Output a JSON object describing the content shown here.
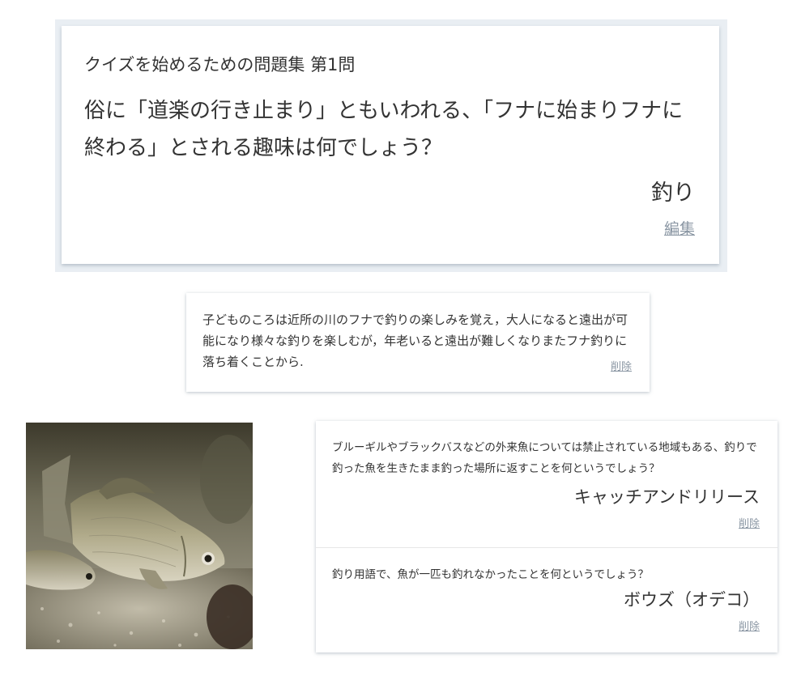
{
  "quiz": {
    "label": "クイズを始めるための問題集 第1問",
    "question": "俗に「道楽の行き止まり」ともいわれる、「フナに始まりフナに終わる」とされる趣味は何でしょう？",
    "answer": "釣り",
    "edit_label": "編集"
  },
  "explanation": {
    "text": "子どものころは近所の川のフナで釣りの楽しみを覚え，大人になると遠出が可能になり様々な釣りを楽しむが，年老いると遠出が難しくなりまたフナ釣りに落ち着くことから.",
    "delete_label": "削除"
  },
  "image": {
    "subject": "fish-photo"
  },
  "related": [
    {
      "question": "ブルーギルやブラックバスなどの外来魚については禁止されている地域もある、釣りで釣った魚を生きたまま釣った場所に返すことを何というでしょう？",
      "answer": "キャッチアンドリリース",
      "delete_label": "削除"
    },
    {
      "question": "釣り用語で、魚が一匹も釣れなかったことを何というでしょう？",
      "answer": "ボウズ（オデコ）",
      "delete_label": "削除"
    }
  ]
}
